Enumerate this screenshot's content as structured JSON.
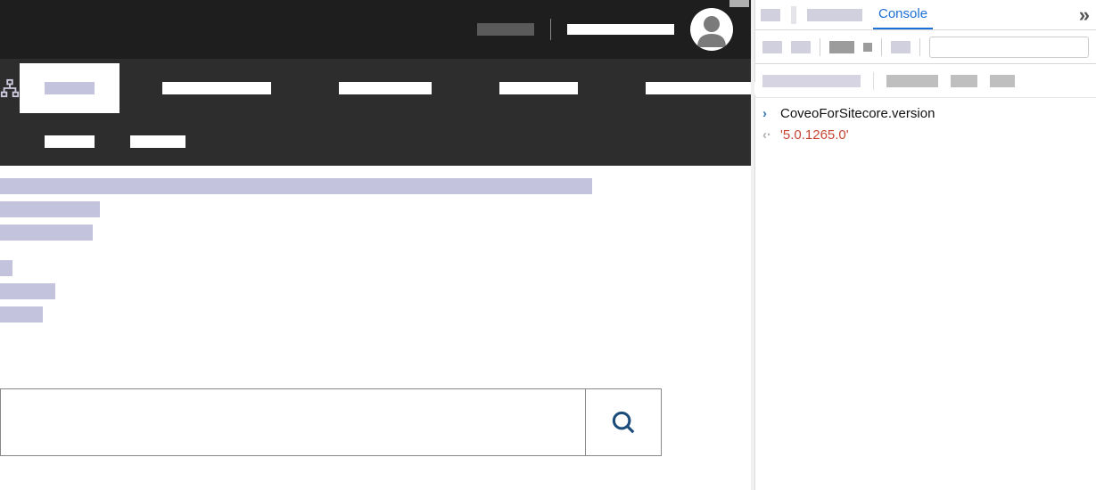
{
  "devtools": {
    "tabs": {
      "console_label": "Console"
    },
    "console": {
      "input": "CoveoForSitecore.version",
      "output": "'5.0.1265.0'"
    }
  },
  "search": {
    "placeholder": ""
  }
}
